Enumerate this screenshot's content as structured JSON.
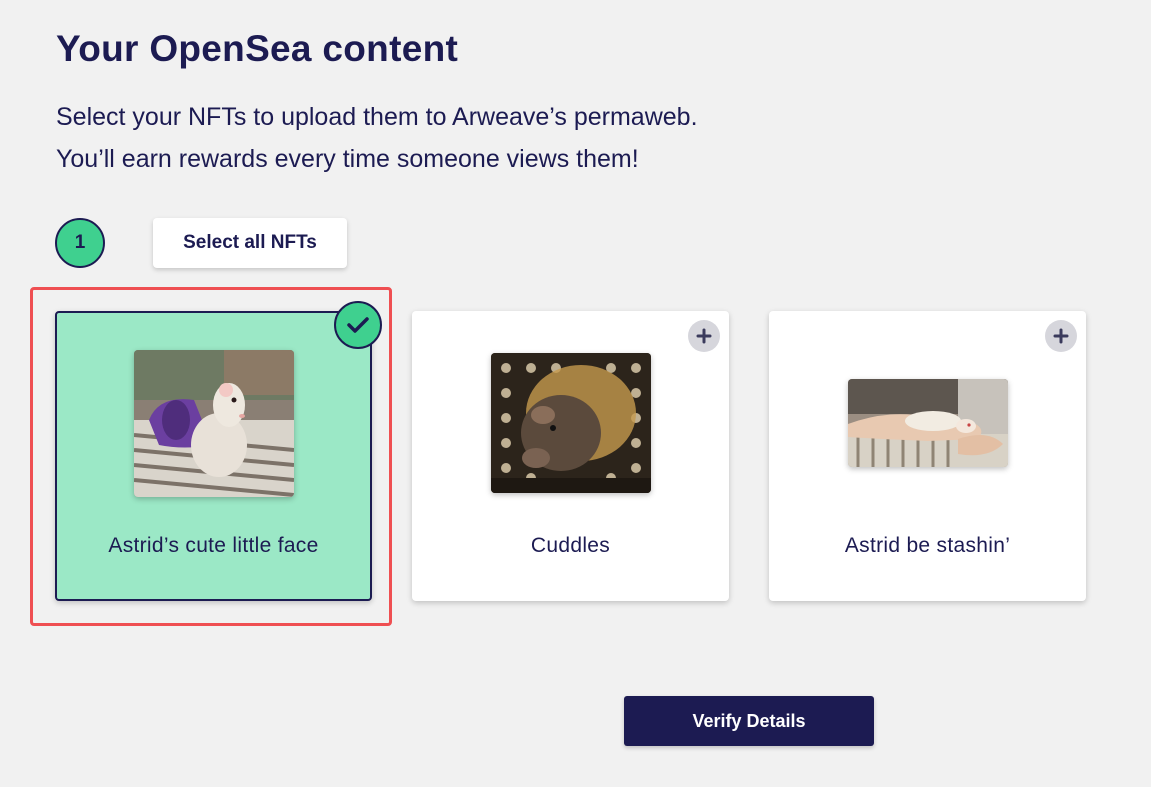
{
  "header": {
    "title": "Your OpenSea content",
    "description_line1": "Select your NFTs to upload them to Arweave’s permaweb.",
    "description_line2": "You’ll earn rewards every time someone views them!"
  },
  "step": {
    "number": "1",
    "select_all_label": "Select all NFTs"
  },
  "nfts": [
    {
      "name": "Astrid’s cute little face",
      "selected": true,
      "status_icon": "check-icon"
    },
    {
      "name": "Cuddles",
      "selected": false,
      "status_icon": "plus-icon"
    },
    {
      "name": "Astrid be stashin’",
      "selected": false,
      "status_icon": "plus-icon"
    }
  ],
  "footer": {
    "verify_label": "Verify Details"
  },
  "colors": {
    "navy": "#1c1b52",
    "green": "#3fd08f",
    "selected_card": "#9be8c6",
    "highlight": "#ef4f52",
    "background": "#f1f1f1"
  }
}
